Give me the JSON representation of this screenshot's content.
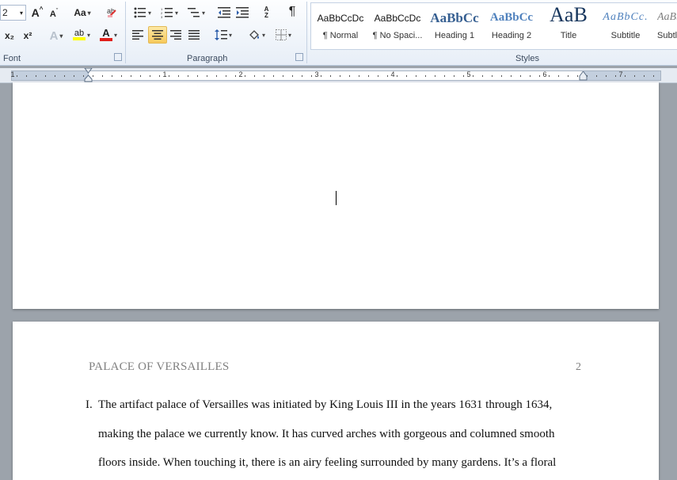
{
  "ribbon": {
    "font_group": {
      "label": "Font",
      "size_value": "2",
      "grow_icon": "A",
      "shrink_icon": "A",
      "case_label": "Aa",
      "subscript": "x₂",
      "superscript": "x²",
      "effects_icon": "A",
      "highlight_label": "ab",
      "highlight_color": "#ffff00",
      "font_color_label": "A",
      "font_color": "#e0201b"
    },
    "paragraph_group": {
      "label": "Paragraph",
      "pilcrow": "¶",
      "sort_label": "AZ"
    },
    "styles_group": {
      "label": "Styles",
      "styles": [
        {
          "preview": "AaBbCcDc",
          "name": "¶ Normal"
        },
        {
          "preview": "AaBbCcDc",
          "name": "¶ No Spaci..."
        },
        {
          "preview": "AaBbCc",
          "name": "Heading 1"
        },
        {
          "preview": "AaBbCc",
          "name": "Heading 2"
        },
        {
          "preview": "AaB",
          "name": "Title"
        },
        {
          "preview": "AaBbCc.",
          "name": "Subtitle"
        },
        {
          "preview": "AaBbCcDc",
          "name": "Subtle Em..."
        }
      ]
    }
  },
  "ruler": {
    "numbers": [
      "1",
      "1",
      "2",
      "3",
      "4",
      "5",
      "6",
      "7"
    ]
  },
  "page2": {
    "header_title": "PALACE OF VERSAILLES",
    "page_number": "2",
    "list_marker": "I.",
    "lines": [
      "The artifact palace of Versailles was initiated by King Louis III in the years 1631 through 1634,",
      "making the palace we currently know. It has curved arches with gorgeous and columned smooth",
      "floors inside. When touching it, there is an airy feeling surrounded by many gardens. It’s a floral"
    ]
  }
}
